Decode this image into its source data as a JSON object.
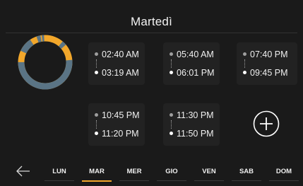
{
  "header": {
    "title": "Martedì"
  },
  "colors": {
    "accent": "#f2a72b",
    "secondary": "#5a7485",
    "card": "#222222",
    "background": "#1a1a1a"
  },
  "programs": [
    {
      "start": "02:40 AM",
      "end": "03:19 AM"
    },
    {
      "start": "05:40 AM",
      "end": "06:01 PM"
    },
    {
      "start": "07:40 PM",
      "end": "09:45 PM"
    },
    {
      "start": "10:45 PM",
      "end": "11:20 PM"
    },
    {
      "start": "11:30 PM",
      "end": "11:50 PM"
    }
  ],
  "actions": {
    "add_icon": "plus-circle-icon",
    "back_icon": "arrow-left-icon"
  },
  "days": [
    {
      "label": "LUN",
      "active": false
    },
    {
      "label": "MAR",
      "active": true
    },
    {
      "label": "MER",
      "active": false
    },
    {
      "label": "GIO",
      "active": false
    },
    {
      "label": "VEN",
      "active": false
    },
    {
      "label": "SAB",
      "active": false
    },
    {
      "label": "DOM",
      "active": false
    }
  ]
}
